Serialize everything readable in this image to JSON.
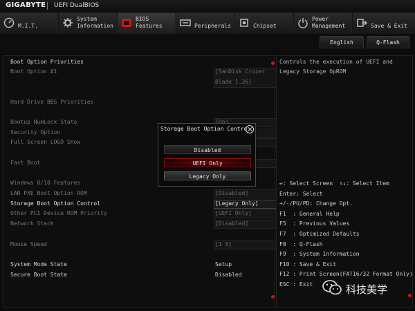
{
  "header": {
    "brand": "GIGABYTE",
    "title": "UEFI DualBIOS"
  },
  "tabs": [
    {
      "label": "M.I.T.",
      "icon": "mit-gauge-icon"
    },
    {
      "label": "System\nInformation",
      "icon": "system-info-icon"
    },
    {
      "label": "BIOS\nFeatures",
      "icon": "bios-features-icon",
      "active": true
    },
    {
      "label": "Peripherals",
      "icon": "peripherals-icon"
    },
    {
      "label": "Chipset",
      "icon": "chipset-icon"
    },
    {
      "label": "Power\nManagement",
      "icon": "power-icon"
    },
    {
      "label": "Save & Exit",
      "icon": "save-exit-icon"
    }
  ],
  "subbar": {
    "language_button": "English",
    "qflash_button": "Q-Flash"
  },
  "settings": {
    "boot_option_priorities": "Boot Option Priorities",
    "boot_option_1_label": "Boot Option #1",
    "boot_option_1_value_line1": "[SanDisk Cruzer",
    "boot_option_1_value_line2": "Blade 1.26]",
    "hdd_bbs_priorities": "Hard Drive BBS Priorities",
    "bootup_numlock_label": "Bootup NumLock State",
    "bootup_numlock_value": "[On]",
    "security_option_label": "Security Option",
    "full_screen_logo_label": "Full Screen LOGO Show",
    "fast_boot_label": "Fast Boot",
    "windows_features_label": "Windows 8/10 Features",
    "lan_pxe_label": "LAN PXE Boot Option ROM",
    "lan_pxe_value": "[Disabled]",
    "storage_boot_label": "Storage Boot Option Control",
    "storage_boot_value": "[Legacy Only]",
    "other_pci_label": "Other PCI Device ROM Priority",
    "other_pci_value": "[UEFI Only]",
    "network_stack_label": "Network Stack",
    "network_stack_value": "[Disabled]",
    "mouse_speed_label": "Mouse Speed",
    "mouse_speed_value": "[1 X]",
    "system_mode_label": "System Mode State",
    "system_mode_value": "Setup",
    "secure_boot_label": "Secure Boot State",
    "secure_boot_value": "Disabled"
  },
  "help": {
    "description_line1": "Controls the execution of UEFI and",
    "description_line2": "Legacy Storage OpROM",
    "keys": [
      "↔: Select Screen  ↑↓: Select Item",
      "Enter: Select",
      "+/-/PU/PD: Change Opt.",
      "F1  : General Help",
      "F5  : Previous Values",
      "F7  : Optimized Defaults",
      "F8  : Q-Flash",
      "F9  : System Information",
      "F10 : Save & Exit",
      "F12 : Print Screen(FAT16/32 Format Only)",
      "ESC : Exit"
    ]
  },
  "popup": {
    "title": "Storage Boot Option Contro",
    "options": [
      "Disabled",
      "UEFI Only",
      "Legacy Only"
    ],
    "highlighted": "UEFI Only",
    "current": "Legacy Only"
  },
  "watermark": {
    "text": "科技美学"
  },
  "colors": {
    "accent_red": "#d01818",
    "background": "#0c0c0c",
    "text_dim": "#777777",
    "text_bright": "#d4d4d4"
  }
}
